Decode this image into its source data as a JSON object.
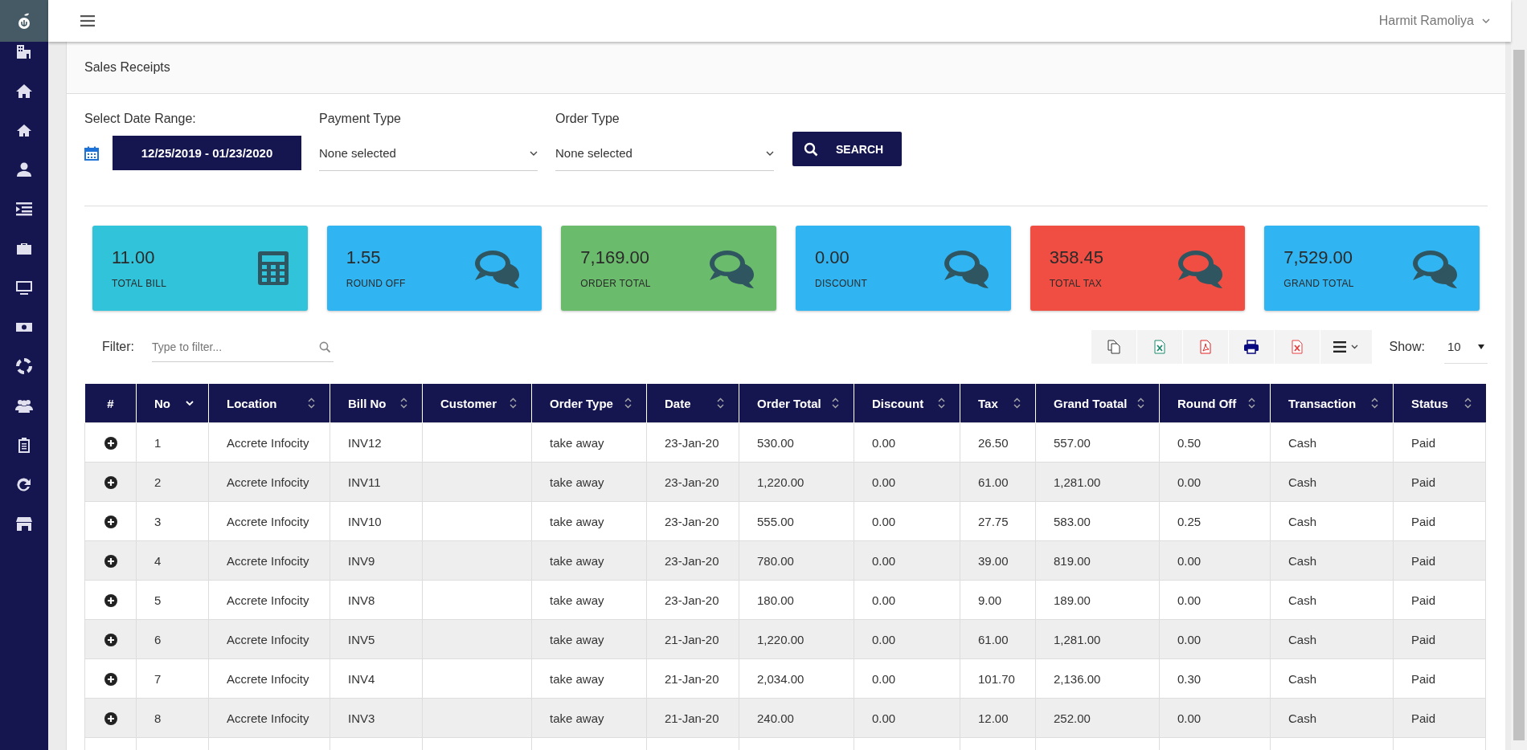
{
  "header": {
    "user_name": "Harmit Ramoliya"
  },
  "panel": {
    "title": "Sales Receipts"
  },
  "filters": {
    "date_range": {
      "label": "Select Date Range:",
      "value": "12/25/2019 - 01/23/2020"
    },
    "payment_type": {
      "label": "Payment Type",
      "value": "None selected"
    },
    "order_type": {
      "label": "Order Type",
      "value": "None selected"
    },
    "search_button": "SEARCH"
  },
  "cards": [
    {
      "value": "11.00",
      "label": "TOTAL BILL",
      "color": "#30c3d9",
      "kind": "calculator"
    },
    {
      "value": "1.55",
      "label": "ROUND OFF",
      "color": "#31b5f2",
      "kind": "chat"
    },
    {
      "value": "7,169.00",
      "label": "ORDER TOTAL",
      "color": "#6bbb6c",
      "kind": "chat"
    },
    {
      "value": "0.00",
      "label": "DISCOUNT",
      "color": "#31b5f2",
      "kind": "chat"
    },
    {
      "value": "358.45",
      "label": "TOTAL TAX",
      "color": "#f04e43",
      "kind": "chat"
    },
    {
      "value": "7,529.00",
      "label": "GRAND TOTAL",
      "color": "#31b5f2",
      "kind": "chat"
    }
  ],
  "table_tools": {
    "filter_label": "Filter:",
    "filter_placeholder": "Type to filter...",
    "show_label": "Show:",
    "page_size": "10"
  },
  "table": {
    "columns": [
      {
        "label": "#",
        "kind": "plain"
      },
      {
        "label": "No",
        "kind": "sortable",
        "sorted": true
      },
      {
        "label": "Location",
        "kind": "sortable",
        "sorted": false
      },
      {
        "label": "Bill No",
        "kind": "sortable",
        "sorted": false
      },
      {
        "label": "Customer",
        "kind": "sortable",
        "sorted": false
      },
      {
        "label": "Order Type",
        "kind": "sortable",
        "sorted": false
      },
      {
        "label": "Date",
        "kind": "sortable",
        "sorted": false
      },
      {
        "label": "Order Total",
        "kind": "sortable",
        "sorted": false
      },
      {
        "label": "Discount",
        "kind": "sortable",
        "sorted": false
      },
      {
        "label": "Tax",
        "kind": "sortable",
        "sorted": false
      },
      {
        "label": "Grand Toatal",
        "kind": "sortable",
        "sorted": false
      },
      {
        "label": "Round Off",
        "kind": "sortable",
        "sorted": false
      },
      {
        "label": "Transaction",
        "kind": "sortable",
        "sorted": false
      },
      {
        "label": "Status",
        "kind": "sortable",
        "sorted": false
      }
    ],
    "rows": [
      {
        "cells": [
          "",
          "1",
          "Accrete Infocity",
          "INV12",
          "",
          "take away",
          "23-Jan-20",
          "530.00",
          "0.00",
          "26.50",
          "557.00",
          "0.50",
          "Cash",
          "Paid"
        ]
      },
      {
        "cells": [
          "",
          "2",
          "Accrete Infocity",
          "INV11",
          "",
          "take away",
          "23-Jan-20",
          "1,220.00",
          "0.00",
          "61.00",
          "1,281.00",
          "0.00",
          "Cash",
          "Paid"
        ]
      },
      {
        "cells": [
          "",
          "3",
          "Accrete Infocity",
          "INV10",
          "",
          "take away",
          "23-Jan-20",
          "555.00",
          "0.00",
          "27.75",
          "583.00",
          "0.25",
          "Cash",
          "Paid"
        ]
      },
      {
        "cells": [
          "",
          "4",
          "Accrete Infocity",
          "INV9",
          "",
          "take away",
          "23-Jan-20",
          "780.00",
          "0.00",
          "39.00",
          "819.00",
          "0.00",
          "Cash",
          "Paid"
        ]
      },
      {
        "cells": [
          "",
          "5",
          "Accrete Infocity",
          "INV8",
          "",
          "take away",
          "23-Jan-20",
          "180.00",
          "0.00",
          "9.00",
          "189.00",
          "0.00",
          "Cash",
          "Paid"
        ]
      },
      {
        "cells": [
          "",
          "6",
          "Accrete Infocity",
          "INV5",
          "",
          "take away",
          "21-Jan-20",
          "1,220.00",
          "0.00",
          "61.00",
          "1,281.00",
          "0.00",
          "Cash",
          "Paid"
        ]
      },
      {
        "cells": [
          "",
          "7",
          "Accrete Infocity",
          "INV4",
          "",
          "take away",
          "21-Jan-20",
          "2,034.00",
          "0.00",
          "101.70",
          "2,136.00",
          "0.30",
          "Cash",
          "Paid"
        ]
      },
      {
        "cells": [
          "",
          "8",
          "Accrete Infocity",
          "INV3",
          "",
          "take away",
          "21-Jan-20",
          "240.00",
          "0.00",
          "12.00",
          "252.00",
          "0.00",
          "Cash",
          "Paid"
        ]
      }
    ]
  }
}
